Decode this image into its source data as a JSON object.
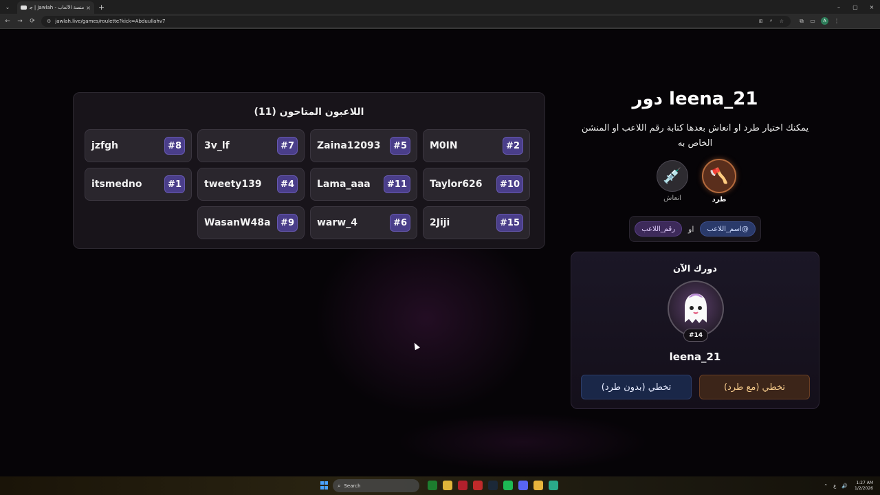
{
  "browser": {
    "tab_title": "منصة الألعاب - Jawlah | جولة",
    "tab_close": "×",
    "new_tab": "+",
    "url": "jawlah.live/games/roulette?kick=Abduullahv7",
    "window_controls": [
      "–",
      "▢",
      "×"
    ],
    "nav": [
      "←",
      "→",
      "⟳"
    ],
    "omnibox_icons": [
      "⊞",
      "⌕",
      "☆"
    ],
    "extension_icons": [
      "⧉",
      "▭"
    ],
    "profile_initial": "A",
    "menu": "⋮"
  },
  "players_panel": {
    "title": "اللاعبون المتاحون (11)",
    "players": [
      {
        "name": "M0IN",
        "number": "#2"
      },
      {
        "name": "Zaina12093",
        "number": "#5"
      },
      {
        "name": "3v_lf",
        "number": "#7"
      },
      {
        "name": "jzfgh",
        "number": "#8"
      },
      {
        "name": "Taylor626",
        "number": "#10"
      },
      {
        "name": "Lama_aaa",
        "number": "#11"
      },
      {
        "name": "tweety139",
        "number": "#4"
      },
      {
        "name": "itsmedno",
        "number": "#1"
      },
      {
        "name": "2Jiji",
        "number": "#15"
      },
      {
        "name": "warw_4",
        "number": "#6"
      },
      {
        "name": "WasanW48a",
        "number": "#9"
      }
    ]
  },
  "turn": {
    "title": "دور leena_21",
    "instructions": "يمكنك اختيار طرد او انعاش بعدها كتابة رقم اللاعب او المنشن الخاص به",
    "actions": {
      "kick": {
        "label": "طرد",
        "icon": "🪓"
      },
      "revive": {
        "label": "انعاش",
        "icon": "💉"
      }
    },
    "mention": {
      "name_chip": "@اسم_اللاعب",
      "or": "او",
      "number_chip": "رقم_اللاعب"
    }
  },
  "your_turn": {
    "title": "دورك الآن",
    "badge": "#14",
    "name": "leena_21",
    "skip_with_kick": "تخطي (مع طرد)",
    "skip_without_kick": "تخطي (بدون طرد)"
  },
  "taskbar": {
    "search_placeholder": "Search",
    "tray_lang": "ع",
    "time": "1:27 AM",
    "date": "1/2/2026"
  }
}
